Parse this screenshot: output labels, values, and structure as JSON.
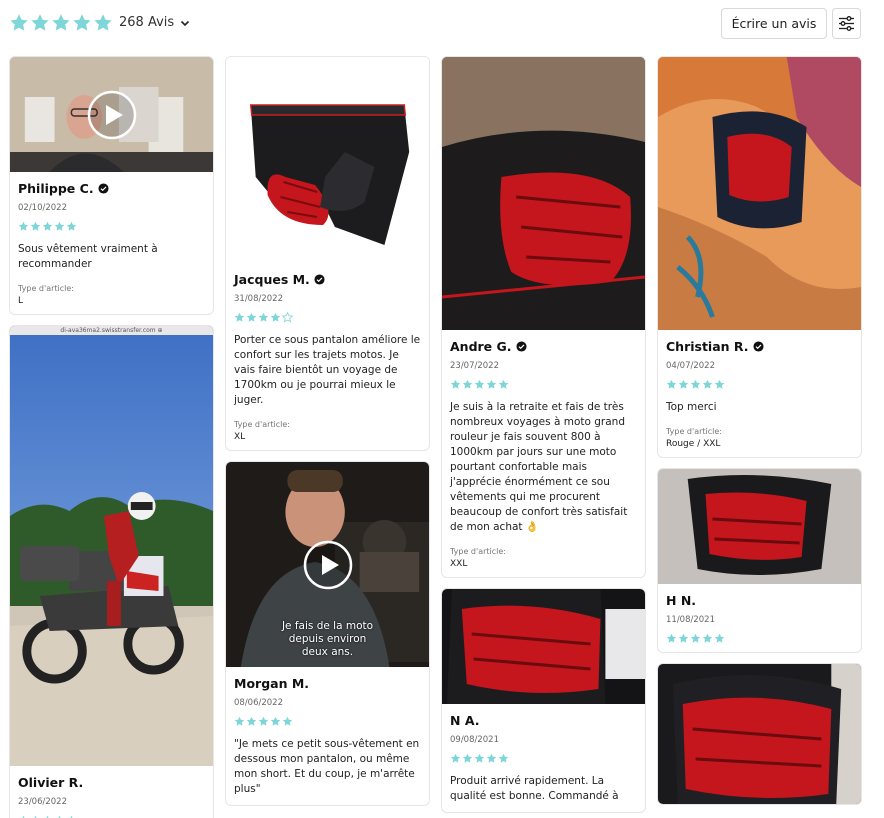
{
  "header": {
    "review_count": "268 Avis",
    "write_review_label": "Écrire un avis",
    "star_color": "#7fd6d8"
  },
  "product_type_label": "Type d'article:",
  "reviews": [
    {
      "author": "Philippe C.",
      "verified": true,
      "date": "02/10/2022",
      "rating": 5,
      "text": "Sous vêtement vraiment à recommander",
      "product_type": "L",
      "media": "video"
    },
    {
      "author": "Olivier R.",
      "verified": false,
      "date": "23/06/2022",
      "rating": 5,
      "text": "",
      "product_type": "",
      "media": "photo",
      "photo_caption_top": "di-ava36ma2.swisstransfer.com ⊕"
    },
    {
      "author": "Jacques M.",
      "verified": true,
      "date": "31/08/2022",
      "rating": 4,
      "text": "Porter ce sous pantalon améliore le confort sur les trajets motos. Je vais faire bientôt un voyage de 1700km ou je pourrai mieux le juger.",
      "product_type": "XL",
      "media": "photo"
    },
    {
      "author": "Morgan M.",
      "verified": false,
      "date": "08/06/2022",
      "rating": 5,
      "text": "\"Je mets ce petit sous-vêtement en dessous mon pantalon, ou même mon short. Et du coup, je m'arrête plus\"",
      "product_type": "",
      "media": "video",
      "video_caption": "Je fais de la moto depuis environ deux ans."
    },
    {
      "author": "Andre G.",
      "verified": true,
      "date": "23/07/2022",
      "rating": 5,
      "text": "Je suis à la retraite et fais de très nombreux voyages à moto grand rouleur je fais souvent 800 à 1000km par jours sur une moto pourtant confortable mais j'apprécie énormément ce sou vêtements qui me procurent beaucoup de confort très satisfait de mon achat 👌",
      "product_type": "XXL",
      "media": "photo"
    },
    {
      "author": "N A.",
      "verified": false,
      "date": "09/08/2021",
      "rating": 5,
      "text": "Produit arrivé rapidement. La qualité est bonne. Commandé à",
      "product_type": "",
      "media": "photo"
    },
    {
      "author": "Christian R.",
      "verified": true,
      "date": "04/07/2022",
      "rating": 5,
      "text": "Top merci",
      "product_type": "Rouge / XXL",
      "media": "photo"
    },
    {
      "author": "H N.",
      "verified": false,
      "date": "11/08/2021",
      "rating": 5,
      "text": "",
      "product_type": "",
      "media": "photo"
    },
    {
      "author": "",
      "verified": false,
      "date": "",
      "rating": 0,
      "text": "",
      "product_type": "",
      "media": "photo"
    }
  ]
}
